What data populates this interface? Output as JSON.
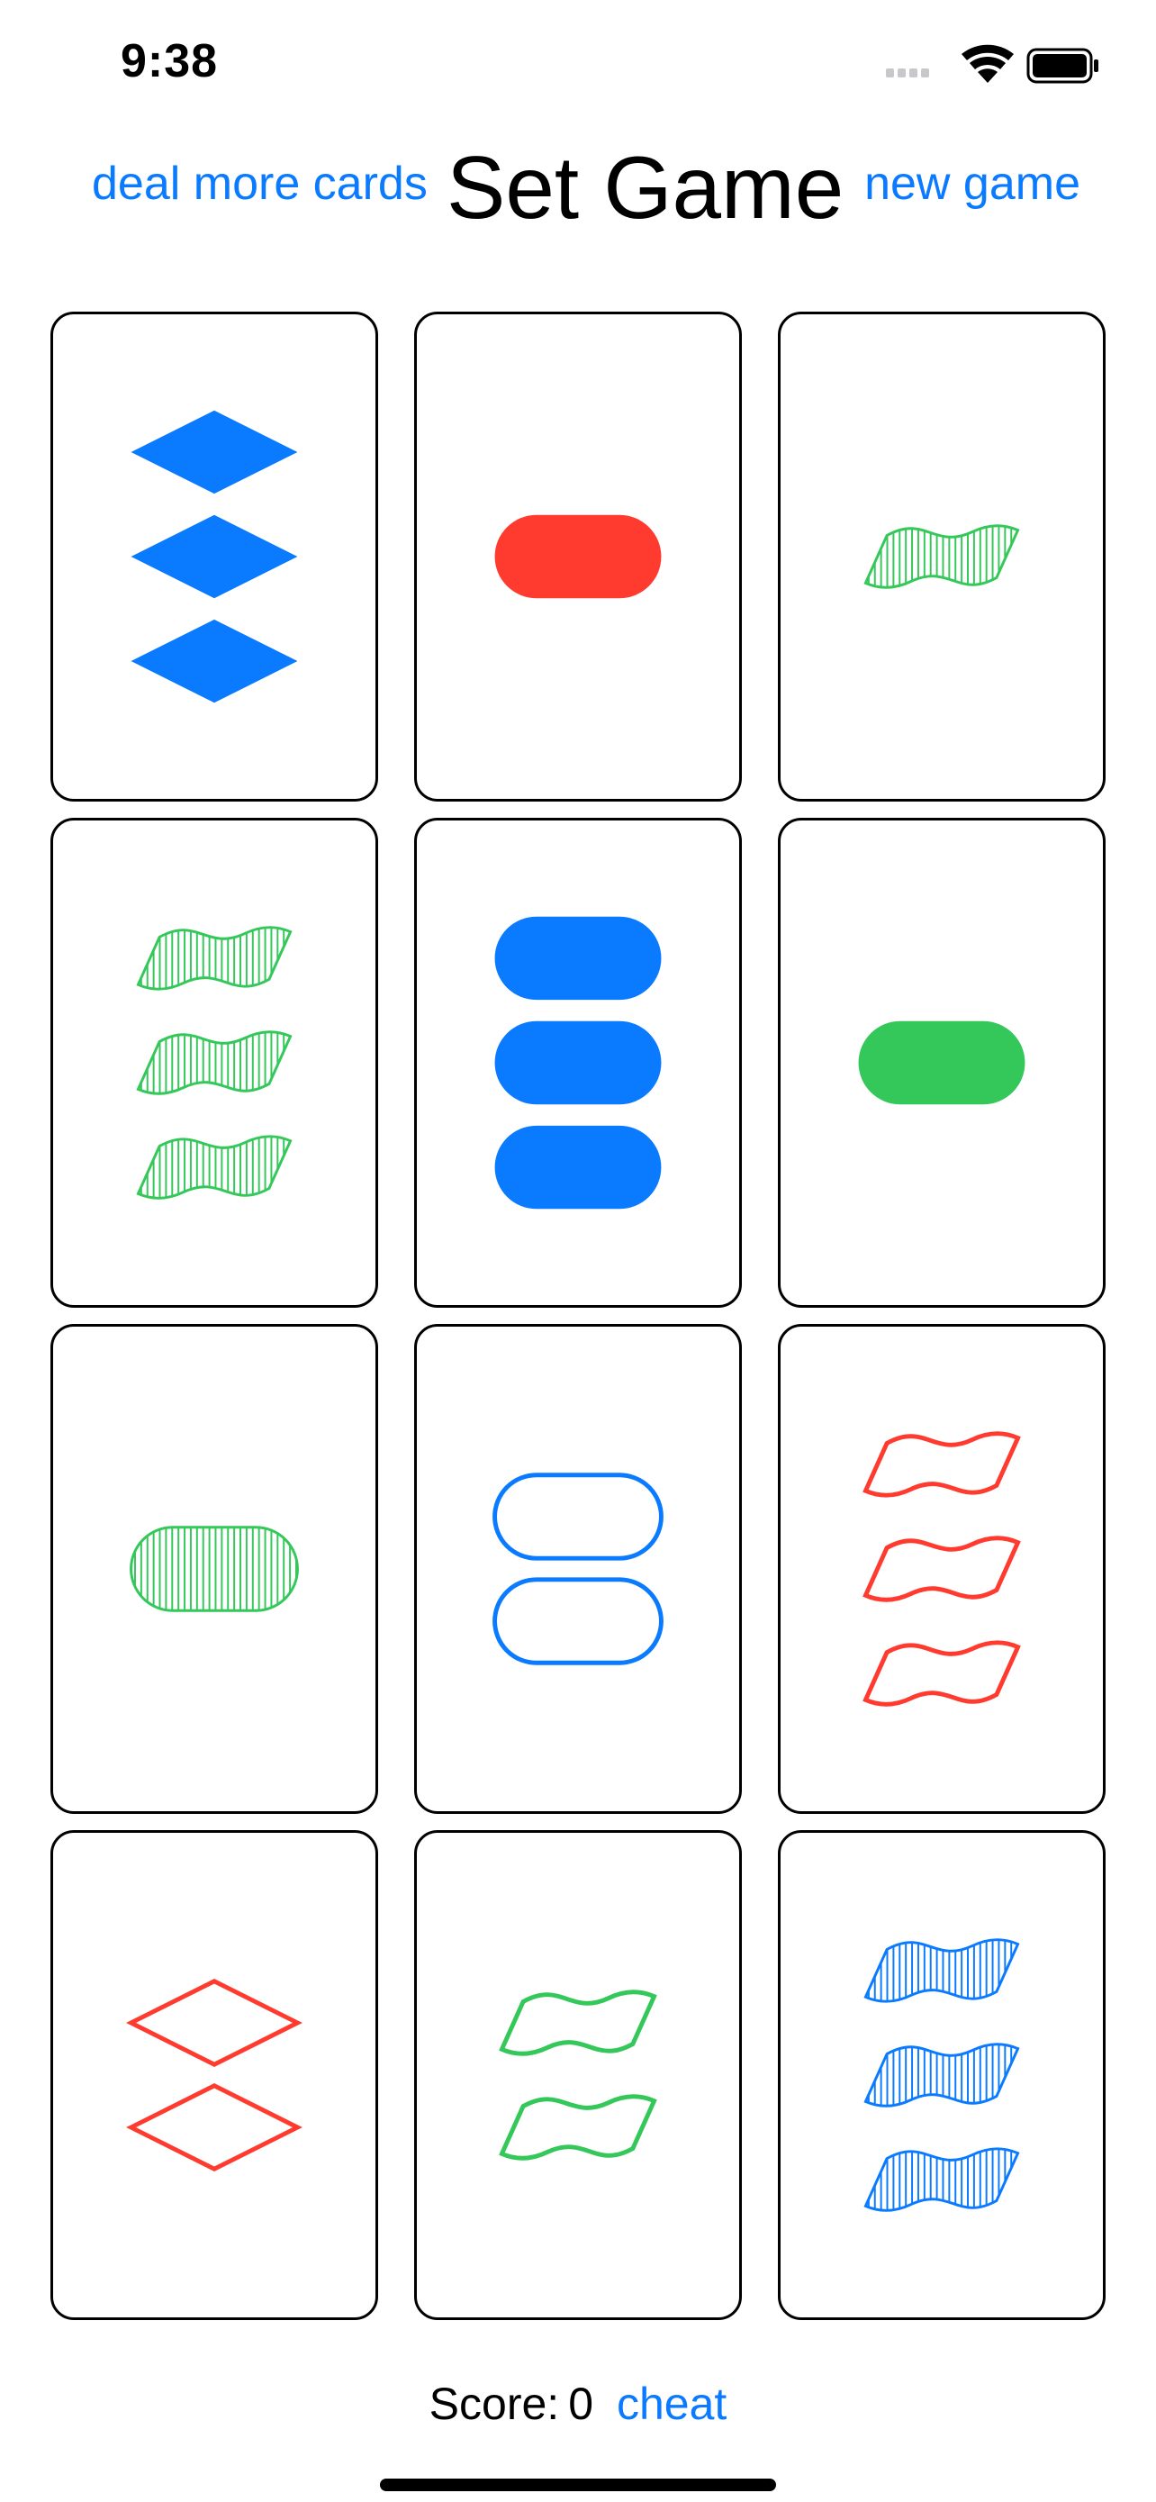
{
  "status_bar": {
    "time": "9:38"
  },
  "header": {
    "deal_label": "deal more cards",
    "title": "Set Game",
    "new_game_label": "new game"
  },
  "colors": {
    "blue": "#0a7aff",
    "red": "#ff3b30",
    "green": "#34c759",
    "link": "#0a7aff"
  },
  "cards": [
    {
      "count": 3,
      "shape": "diamond",
      "fill": "solid",
      "color": "blue"
    },
    {
      "count": 1,
      "shape": "oval",
      "fill": "solid",
      "color": "red"
    },
    {
      "count": 1,
      "shape": "squiggle",
      "fill": "striped",
      "color": "green"
    },
    {
      "count": 3,
      "shape": "squiggle",
      "fill": "striped",
      "color": "green"
    },
    {
      "count": 3,
      "shape": "oval",
      "fill": "solid",
      "color": "blue"
    },
    {
      "count": 1,
      "shape": "oval",
      "fill": "solid",
      "color": "green"
    },
    {
      "count": 1,
      "shape": "oval",
      "fill": "striped",
      "color": "green"
    },
    {
      "count": 2,
      "shape": "oval",
      "fill": "open",
      "color": "blue"
    },
    {
      "count": 3,
      "shape": "squiggle",
      "fill": "open",
      "color": "red"
    },
    {
      "count": 2,
      "shape": "diamond",
      "fill": "open",
      "color": "red"
    },
    {
      "count": 2,
      "shape": "squiggle",
      "fill": "open",
      "color": "green"
    },
    {
      "count": 3,
      "shape": "squiggle",
      "fill": "striped",
      "color": "blue"
    }
  ],
  "footer": {
    "score_label": "Score:",
    "score_value": "0",
    "cheat_label": "cheat"
  }
}
